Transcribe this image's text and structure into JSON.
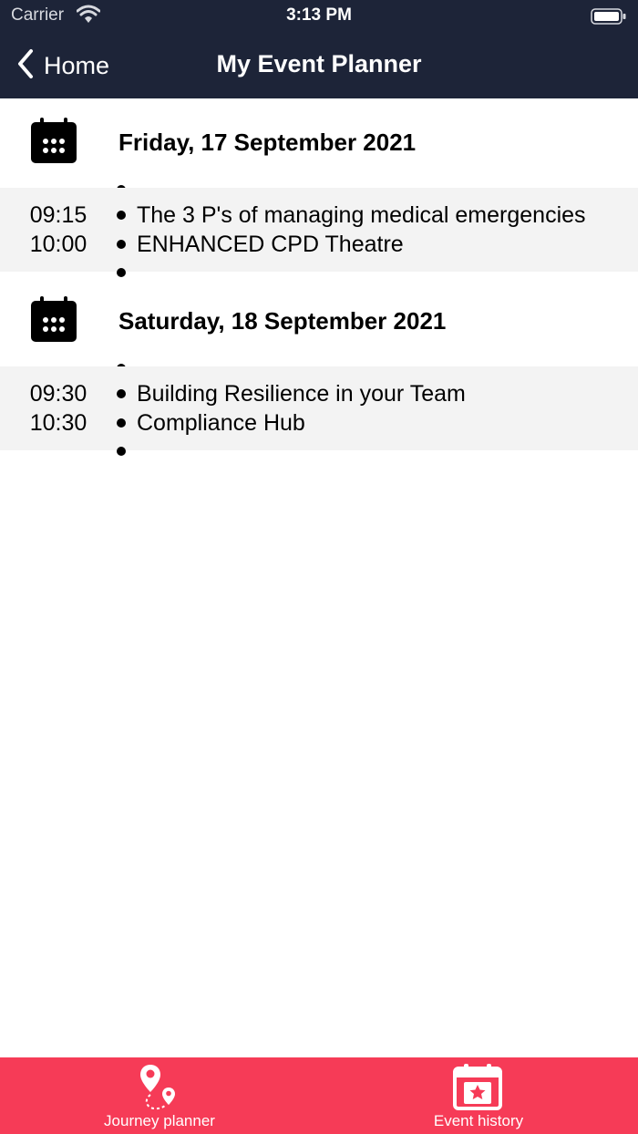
{
  "status_bar": {
    "carrier": "Carrier",
    "time": "3:13 PM"
  },
  "nav": {
    "back_label": "Home",
    "title": "My Event Planner"
  },
  "days": [
    {
      "date": "Friday, 17 September 2021",
      "events": [
        {
          "start": "09:15",
          "end": "10:00",
          "title": "The 3 P's of managing medical emergencies",
          "location": "ENHANCED CPD Theatre"
        }
      ]
    },
    {
      "date": "Saturday, 18 September 2021",
      "events": [
        {
          "start": "09:30",
          "end": "10:30",
          "title": "Building Resilience in your Team",
          "location": "Compliance Hub"
        }
      ]
    }
  ],
  "tabs": [
    {
      "label": "Journey planner",
      "icon": "map-pin-route-icon"
    },
    {
      "label": "Event history",
      "icon": "calendar-star-icon"
    }
  ],
  "colors": {
    "header": "#1d2438",
    "tabbar": "#f63b57",
    "event_row": "#f3f3f3"
  }
}
